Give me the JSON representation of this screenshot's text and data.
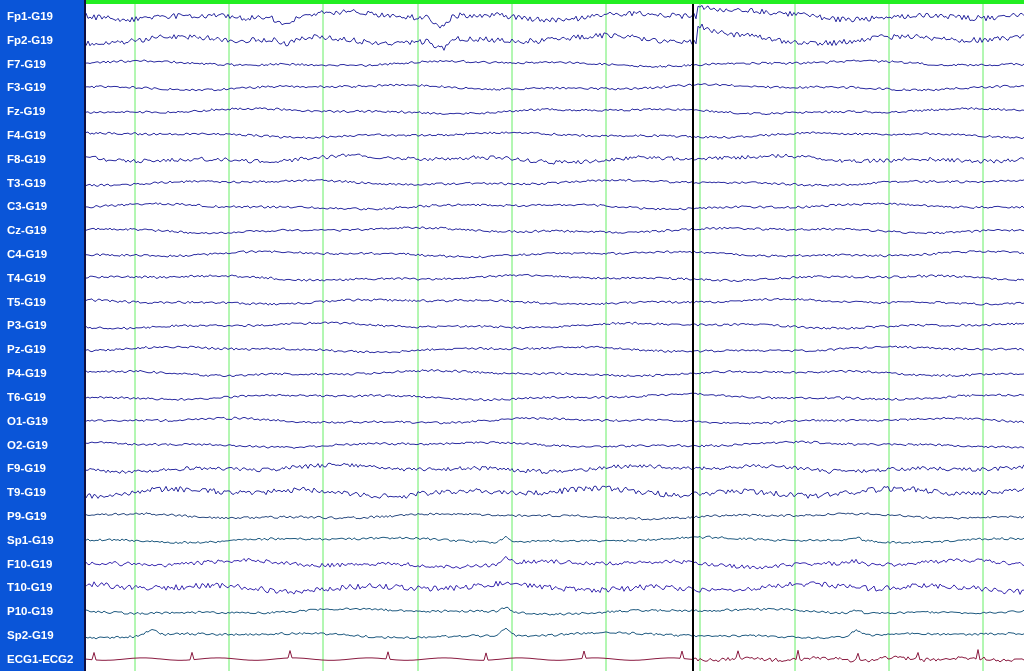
{
  "channels": [
    {
      "label": "Fp1-G19",
      "color": "#2a2aa0"
    },
    {
      "label": "Fp2-G19",
      "color": "#2a2aa0"
    },
    {
      "label": "F7-G19",
      "color": "#2a2aa0"
    },
    {
      "label": "F3-G19",
      "color": "#2a2aa0"
    },
    {
      "label": "Fz-G19",
      "color": "#2a2aa0"
    },
    {
      "label": "F4-G19",
      "color": "#2a2aa0"
    },
    {
      "label": "F8-G19",
      "color": "#2a2aa0"
    },
    {
      "label": "T3-G19",
      "color": "#2a2aa0"
    },
    {
      "label": "C3-G19",
      "color": "#2a2aa0"
    },
    {
      "label": "Cz-G19",
      "color": "#2a2aa0"
    },
    {
      "label": "C4-G19",
      "color": "#2a2aa0"
    },
    {
      "label": "T4-G19",
      "color": "#2a2aa0"
    },
    {
      "label": "T5-G19",
      "color": "#2a2aa0"
    },
    {
      "label": "P3-G19",
      "color": "#2a2aa0"
    },
    {
      "label": "Pz-G19",
      "color": "#2a2aa0"
    },
    {
      "label": "P4-G19",
      "color": "#2a2aa0"
    },
    {
      "label": "T6-G19",
      "color": "#2a2aa0"
    },
    {
      "label": "O1-G19",
      "color": "#2a2aa0"
    },
    {
      "label": "O2-G19",
      "color": "#2a2aa0"
    },
    {
      "label": "F9-G19",
      "color": "#2a2aa0"
    },
    {
      "label": "T9-G19",
      "color": "#2a2aa0"
    },
    {
      "label": "P9-G19",
      "color": "#2a4a80"
    },
    {
      "label": "Sp1-G19",
      "color": "#1f5a80"
    },
    {
      "label": "F10-G19",
      "color": "#3a2ab0"
    },
    {
      "label": "T10-G19",
      "color": "#3a2ab0"
    },
    {
      "label": "P10-G19",
      "color": "#1f5a80"
    },
    {
      "label": "Sp2-G19",
      "color": "#1f5a80"
    },
    {
      "label": "ECG1-ECG2",
      "color": "#8a1a40"
    }
  ]
}
